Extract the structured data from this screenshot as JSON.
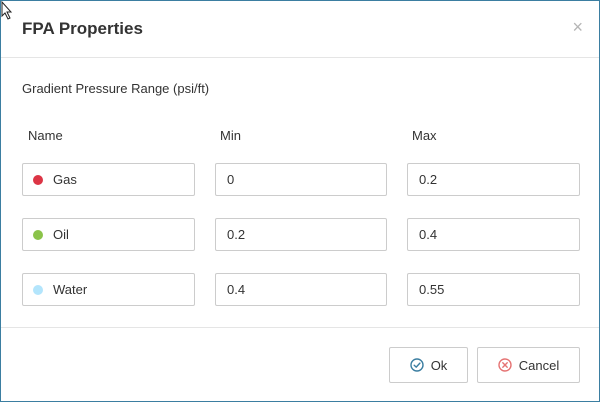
{
  "dialog": {
    "title": "FPA Properties",
    "close_glyph": "×",
    "section_label": "Gradient Pressure Range (psi/ft)"
  },
  "columns": {
    "name": "Name",
    "min": "Min",
    "max": "Max"
  },
  "rows": [
    {
      "name": "Gas",
      "color": "#dc3545",
      "min": "0",
      "max": "0.2"
    },
    {
      "name": "Oil",
      "color": "#8bc34a",
      "min": "0.2",
      "max": "0.4"
    },
    {
      "name": "Water",
      "color": "#b3e5fc",
      "min": "0.4",
      "max": "0.55"
    }
  ],
  "buttons": {
    "ok_label": "Ok",
    "ok_icon": "check-circle-icon",
    "ok_icon_color": "#3b7ea1",
    "cancel_label": "Cancel",
    "cancel_icon": "x-circle-icon",
    "cancel_icon_color": "#e57373"
  }
}
